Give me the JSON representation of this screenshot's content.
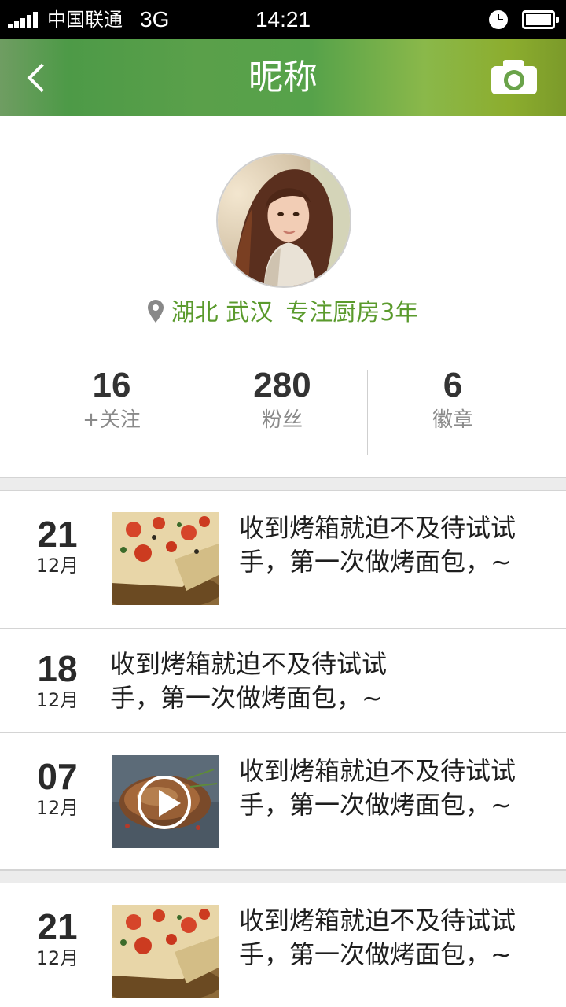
{
  "status_bar": {
    "carrier": "中国联通",
    "network": "3G",
    "time": "14:21"
  },
  "header": {
    "title": "昵称",
    "back_icon": "chevron-left-icon",
    "camera_icon": "camera-icon"
  },
  "profile": {
    "location_icon": "location-pin-icon",
    "city": "湖北 武汉",
    "tagline": "专注厨房3年",
    "stats": [
      {
        "value": "16",
        "label": "+关注"
      },
      {
        "value": "280",
        "label": "粉丝"
      },
      {
        "value": "6",
        "label": "徽章"
      }
    ]
  },
  "colors": {
    "accent_green": "#5a9a2c",
    "header_gradient_start": "#6f9d62",
    "header_gradient_end": "#7b9a2a"
  },
  "posts": [
    {
      "day": "21",
      "month": "12月",
      "text": "收到烤箱就迫不及待试试手，第一次做烤面包，~",
      "thumbnail": "pizza-photo",
      "has_video": false
    },
    {
      "day": "18",
      "month": "12月",
      "text": "收到烤箱就迫不及待试试手，第一次做烤面包，~",
      "thumbnail": null,
      "has_video": false
    },
    {
      "day": "07",
      "month": "12月",
      "text": "收到烤箱就迫不及待试试手，第一次做烤面包，~",
      "thumbnail": "roast-photo",
      "has_video": true
    },
    {
      "day": "21",
      "month": "12月",
      "text": "收到烤箱就迫不及待试试手，第一次做烤面包，~",
      "thumbnail": "pizza-photo",
      "has_video": false
    }
  ]
}
